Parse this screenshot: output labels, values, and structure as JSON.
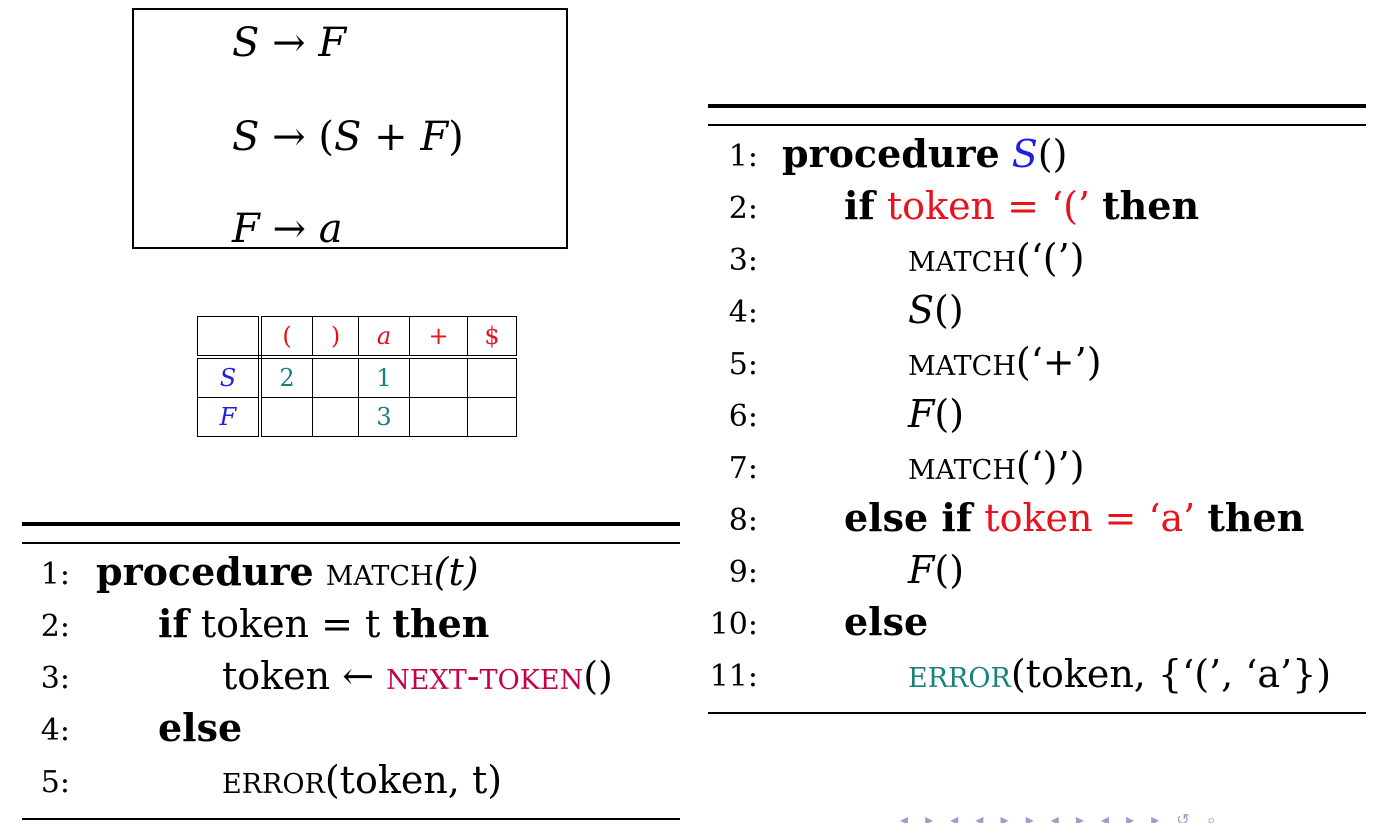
{
  "grammar": {
    "rule1": {
      "lhs": "S",
      "arrow": "→",
      "rhs": "F"
    },
    "rule2": {
      "lhs": "S",
      "arrow": "→",
      "rhs_open": "(",
      "rhs_s": "S",
      "rhs_plus": " + ",
      "rhs_f": "F",
      "rhs_close": ")"
    },
    "rule3": {
      "lhs": "F",
      "arrow": "→",
      "rhs": "a"
    }
  },
  "parse_table": {
    "headers": [
      "(",
      ")",
      "a",
      "+",
      "$"
    ],
    "rows": [
      {
        "nonterminal": "S",
        "cells": [
          "2",
          "",
          "1",
          "",
          ""
        ]
      },
      {
        "nonterminal": "F",
        "cells": [
          "",
          "",
          "3",
          "",
          ""
        ]
      }
    ]
  },
  "match_proc": {
    "lines": [
      {
        "num": "1:",
        "kw": "procedure",
        "name": "match",
        "args": "(t)"
      },
      {
        "num": "2:",
        "kw_if": "if",
        "cond": "token = t",
        "kw_then": "then"
      },
      {
        "num": "3:",
        "lhs": "token ←",
        "call": "next-token",
        "args": "()"
      },
      {
        "num": "4:",
        "kw": "else"
      },
      {
        "num": "5:",
        "call": "error",
        "args": "(token, t)"
      }
    ]
  },
  "s_proc": {
    "lines": [
      {
        "num": "1:",
        "kw": "procedure",
        "name": "S",
        "args": "()"
      },
      {
        "num": "2:",
        "kw_if": "if",
        "cond": "token = ‘(’",
        "kw_then": "then"
      },
      {
        "num": "3:",
        "call": "match",
        "args": "(‘(’)"
      },
      {
        "num": "4:",
        "call": "S",
        "args": "()"
      },
      {
        "num": "5:",
        "call": "match",
        "args": "(‘+’)"
      },
      {
        "num": "6:",
        "call": "F",
        "args": "()"
      },
      {
        "num": "7:",
        "call": "match",
        "args": "(‘)’)"
      },
      {
        "num": "8:",
        "kw_if": "else if",
        "cond": "token = ‘a’",
        "kw_then": "then"
      },
      {
        "num": "9:",
        "call": "F",
        "args": "()"
      },
      {
        "num": "10:",
        "kw": "else"
      },
      {
        "num": "11:",
        "call": "error",
        "args": "(token, {‘(’, ‘a’})"
      }
    ]
  },
  "colors": {
    "terminal": "#e8121e",
    "nonterminal": "#2020e0",
    "rule_number": "#1b8080",
    "next_token": "#c4004c",
    "error": "#1b8080"
  }
}
